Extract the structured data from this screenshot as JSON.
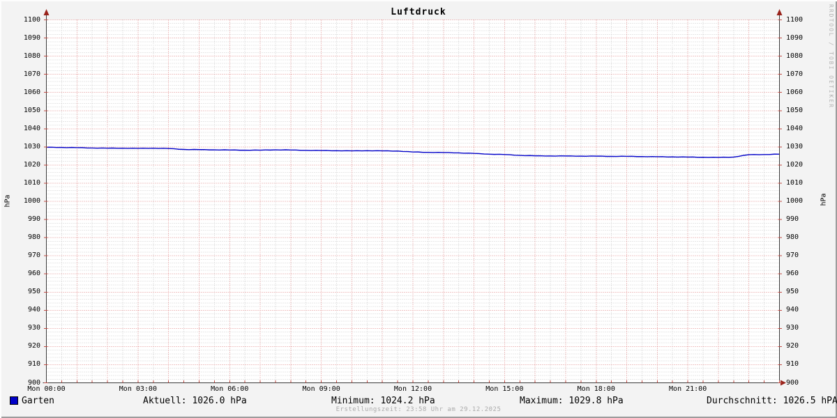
{
  "title": "Luftdruck",
  "watermark": "RRDTOOL / TOBI OETIKER",
  "footer": "Erstellungszeit: 23:58 Uhr am 29.12.2025",
  "legend": {
    "series_label": "Garten",
    "aktuell": "Aktuell: 1026.0 hPa",
    "minimum": "Minimum: 1024.2 hPa",
    "maximum": "Maximum: 1029.8 hPa",
    "durchschnitt": "Durchschnitt: 1026.5 hPA"
  },
  "colors": {
    "series_line": "#0000c8",
    "major_grid": "#e08a8a",
    "minor_grid": "#cfcfcf",
    "axis": "#3a3a3a",
    "arrow": "#99231b",
    "plot_background": "#ffffff",
    "canvas_background": "#f3f3f3",
    "muted_text": "#ababab"
  },
  "chart_data": {
    "type": "line",
    "title": "Luftdruck",
    "xlabel": "",
    "ylabel": "hPa",
    "ylabel_right": "hPa",
    "ylim": [
      900,
      1100
    ],
    "xlim_hours": [
      0,
      24
    ],
    "grid": {
      "x_minor_minutes": 30,
      "x_major_minutes": 60,
      "y_minor": 2,
      "y_major": 10,
      "style": "dotted"
    },
    "legend_position": "bottom",
    "y_ticks": [
      900,
      910,
      920,
      930,
      940,
      950,
      960,
      970,
      980,
      990,
      1000,
      1010,
      1020,
      1030,
      1040,
      1050,
      1060,
      1070,
      1080,
      1090,
      1100
    ],
    "x_ticks": [
      {
        "hour": 0,
        "label": "Mon 00:00"
      },
      {
        "hour": 3,
        "label": "Mon 03:00"
      },
      {
        "hour": 6,
        "label": "Mon 06:00"
      },
      {
        "hour": 9,
        "label": "Mon 09:00"
      },
      {
        "hour": 12,
        "label": "Mon 12:00"
      },
      {
        "hour": 15,
        "label": "Mon 15:00"
      },
      {
        "hour": 18,
        "label": "Mon 18:00"
      },
      {
        "hour": 21,
        "label": "Mon 21:00"
      }
    ],
    "series": [
      {
        "name": "Garten",
        "color": "#0000c8",
        "x_start_hour": 0,
        "x_step_hours": 0.5,
        "values": [
          1029.8,
          1029.7,
          1029.6,
          1029.4,
          1029.3,
          1029.3,
          1029.2,
          1029.3,
          1029.1,
          1028.6,
          1028.5,
          1028.4,
          1028.3,
          1028.2,
          1028.2,
          1028.4,
          1028.3,
          1028.1,
          1028.0,
          1027.9,
          1027.8,
          1027.9,
          1027.8,
          1027.7,
          1027.2,
          1027.0,
          1026.9,
          1026.7,
          1026.4,
          1026.0,
          1025.8,
          1025.3,
          1025.1,
          1025.0,
          1025.0,
          1024.9,
          1024.9,
          1024.8,
          1024.8,
          1024.7,
          1024.6,
          1024.5,
          1024.4,
          1024.3,
          1024.2,
          1024.4,
          1025.7,
          1025.8,
          1026.0
        ]
      }
    ],
    "stats": {
      "aktuell": 1026.0,
      "minimum": 1024.2,
      "maximum": 1029.8,
      "durchschnitt": 1026.5,
      "unit": "hPa"
    }
  }
}
